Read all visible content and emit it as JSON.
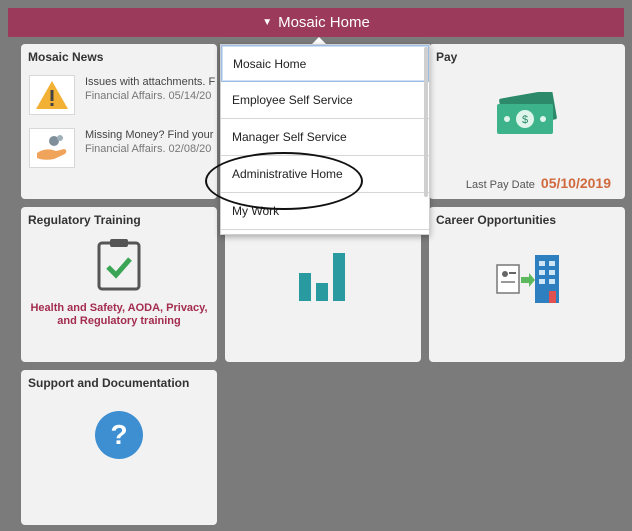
{
  "header": {
    "title": "Mosaic Home"
  },
  "tiles": {
    "news": {
      "title": "Mosaic News",
      "items": [
        {
          "line1": "Issues with attachments. F",
          "line2": "Financial Affairs. 05/14/20"
        },
        {
          "line1": "Missing Money? Find your",
          "line2": "Financial Affairs. 02/08/20"
        }
      ]
    },
    "pay": {
      "title": "Pay",
      "last_pay_label": "Last Pay Date",
      "last_pay_date": "05/10/2019"
    },
    "regulatory": {
      "title": "Regulatory Training",
      "desc_line1": "Health and Safety, AODA, Privacy,",
      "desc_line2": "and Regulatory training"
    },
    "career": {
      "title": "Career Opportunities"
    },
    "support": {
      "title": "Support and Documentation"
    }
  },
  "menu": {
    "items": [
      {
        "label": "Mosaic Home"
      },
      {
        "label": "Employee Self Service"
      },
      {
        "label": "Manager Self Service"
      },
      {
        "label": "Administrative Home"
      },
      {
        "label": "My Work"
      }
    ]
  },
  "colors": {
    "header": "#9b3a5a",
    "background": "#7b7b7b",
    "accent_date": "#d06a3e",
    "reg_text": "#a32c4f"
  }
}
